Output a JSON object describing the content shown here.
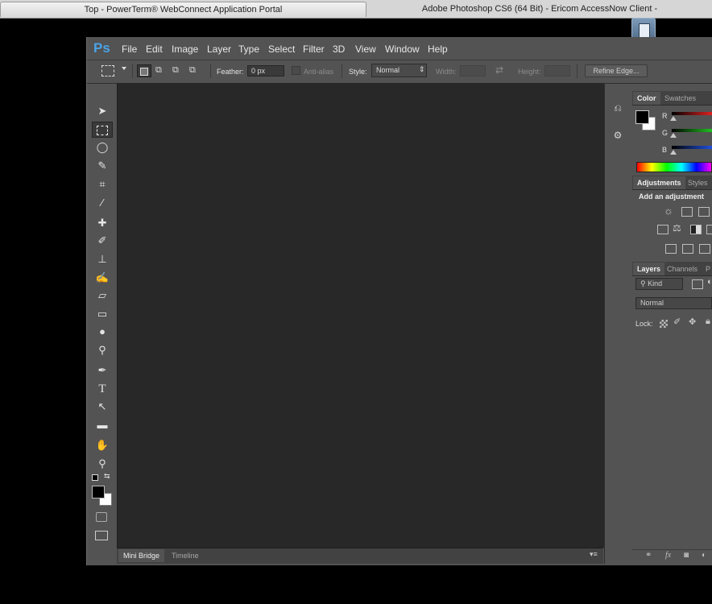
{
  "browser_tabs": [
    {
      "label": "Top - PowerTerm® WebConnect Application Portal"
    },
    {
      "label": "Adobe Photoshop CS6 (64 Bit) - Ericom AccessNow Client -"
    }
  ],
  "app": {
    "logo": "Ps"
  },
  "menu": [
    "File",
    "Edit",
    "Image",
    "Layer",
    "Type",
    "Select",
    "Filter",
    "3D",
    "View",
    "Window",
    "Help"
  ],
  "options": {
    "feather_label": "Feather:",
    "feather_value": "0 px",
    "antialias_label": "Anti-alias",
    "style_label": "Style:",
    "style_value": "Normal",
    "width_label": "Width:",
    "height_label": "Height:",
    "refine_edge": "Refine Edge..."
  },
  "tools": [
    "move-tool-icon",
    "rectangular-marquee-icon",
    "lasso-icon",
    "quick-selection-icon",
    "crop-icon",
    "eyedropper-icon",
    "spot-healing-icon",
    "brush-icon",
    "clone-stamp-icon",
    "history-brush-icon",
    "eraser-icon",
    "gradient-icon",
    "blur-icon",
    "dodge-icon",
    "pen-icon",
    "type-icon",
    "path-selection-icon",
    "rectangle-icon",
    "hand-icon",
    "zoom-icon"
  ],
  "bottom_tabs": [
    "Mini Bridge",
    "Timeline"
  ],
  "color_panel": {
    "tabs": [
      "Color",
      "Swatches"
    ],
    "channels": [
      "R",
      "G",
      "B"
    ],
    "channel_colors": [
      "#d02020",
      "#20b020",
      "#2050e0"
    ]
  },
  "adjustments_panel": {
    "tabs": [
      "Adjustments",
      "Styles"
    ],
    "heading": "Add an adjustment"
  },
  "layers_panel": {
    "tabs": [
      "Layers",
      "Channels",
      "P"
    ],
    "kind_label": "Kind",
    "blend_mode": "Normal",
    "lock_label": "Lock:"
  },
  "colors": {
    "foreground": "#000000",
    "background": "#ffffff",
    "accent": "#4aa3e6"
  }
}
